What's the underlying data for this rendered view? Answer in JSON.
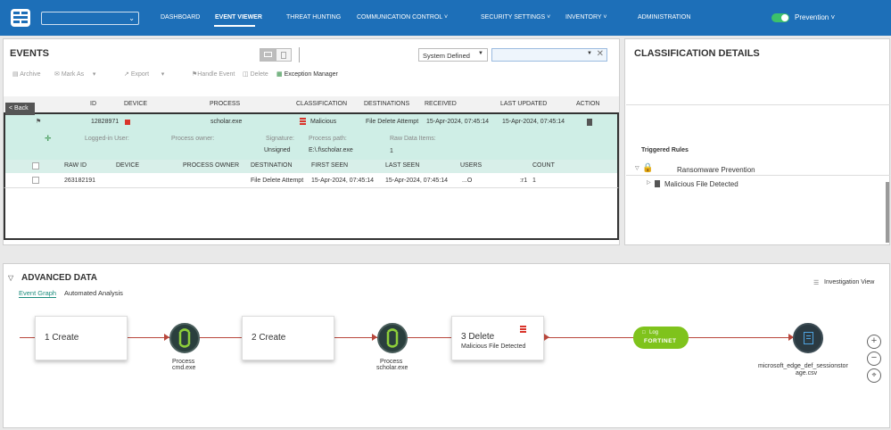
{
  "nav": {
    "items": [
      "DASHBOARD",
      "EVENT VIEWER",
      "THREAT HUNTING",
      "COMMUNICATION CONTROL",
      "SECURITY SETTINGS",
      "INVENTORY",
      "ADMINISTRATION"
    ],
    "mode": "Prevention"
  },
  "events": {
    "title": "EVENTS",
    "filter_value": "System Defined",
    "toolbar": [
      "Archive",
      "Mark As",
      "Export",
      "Handle Event",
      "Delete",
      "Exception Manager"
    ],
    "back_label": "< Back",
    "columns": [
      "ID",
      "DEVICE",
      "PROCESS",
      "CLASSIFICATION",
      "DESTINATIONS",
      "RECEIVED",
      "LAST UPDATED",
      "ACTION"
    ],
    "row": {
      "id": "12828971",
      "process": "scholar.exe",
      "classification": "Malicious",
      "destinations": "File Delete Attempt",
      "received": "15-Apr-2024, 07:45:14",
      "last_updated": "15-Apr-2024, 07:45:14"
    },
    "details": {
      "logged_in_user_label": "Logged-in User:",
      "process_owner_label": "Process owner:",
      "signature_label": "Signature:",
      "signature_value": "Unsigned",
      "process_path_label": "Process path:",
      "process_path_value": "E:\\.f\\scholar.exe",
      "raw_items_label": "Raw Data Items:",
      "raw_items_value": "1"
    },
    "sub_columns": [
      "RAW ID",
      "DEVICE",
      "PROCESS OWNER",
      "DESTINATION",
      "FIRST SEEN",
      "LAST SEEN",
      "USERS",
      "COUNT"
    ],
    "sub_row": {
      "raw_id": "263182191",
      "destination": "File Delete Attempt",
      "first_seen": "15-Apr-2024, 07:45:14",
      "last_seen": "15-Apr-2024, 07:45:14",
      "users": "...O",
      "count_prefix": ":r1",
      "count": "1"
    }
  },
  "classification": {
    "title": "CLASSIFICATION DETAILS",
    "triggered_rules_label": "Triggered Rules",
    "rule_group": "Ransomware Prevention",
    "rule": "Malicious File Detected"
  },
  "advanced": {
    "title": "ADVANCED DATA",
    "tabs": [
      "Event Graph",
      "Automated Analysis"
    ],
    "investigation_view": "Investigation View",
    "nodes": {
      "create1": "1 Create",
      "create2": "2 Create",
      "delete3": "3 Delete",
      "delete3_sub": "Malicious File Detected",
      "process1": "Process",
      "process1_name": "cmd.exe",
      "process2": "Process",
      "process2_name": "scholar.exe",
      "log_label": "Log",
      "log_brand": "FORTINET",
      "file_line1": "microsoft_edge_def_sessionstor",
      "file_line2": "age.csv"
    }
  }
}
